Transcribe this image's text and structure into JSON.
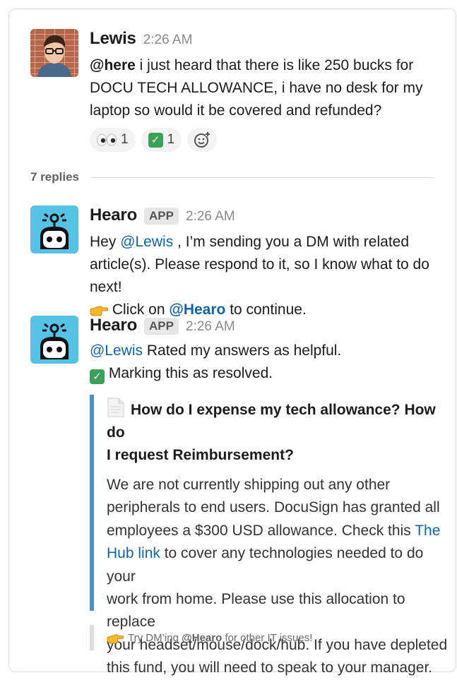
{
  "thread": {
    "replies_label": "7 replies"
  },
  "original_message": {
    "author": "Lewis",
    "time": "2:26 AM",
    "mention": "@here",
    "line1": " i just heard that there is like 250 bucks for",
    "line2": "DOCU TECH ALLOWANCE, i have no desk for my",
    "line3": "laptop so would it be covered and refunded?",
    "reactions": [
      {
        "emoji": "eyes-icon",
        "count": "1"
      },
      {
        "emoji": "white-check-mark-icon",
        "count": "1"
      }
    ]
  },
  "reply1": {
    "author": "Hearo",
    "badge": "APP",
    "time": "2:26 AM",
    "pre": "Hey ",
    "mention": "@Lewis",
    "post": " , I’m sending you a DM with related",
    "line2": "article(s). Please respond to it, so I know what to do next!",
    "click_pre": " Click on ",
    "click_mention": "@Hearo",
    "click_post": " to continue."
  },
  "reply2": {
    "author": "Hearo",
    "badge": "APP",
    "time": "2:26 AM",
    "mention": "@Lewis",
    "rated": " Rated my answers as helpful.",
    "resolved": " Marking this as resolved.",
    "attachment": {
      "title_line1": "How do I expense my tech allowance? How do",
      "title_line2": "I request Reimbursement?",
      "b1": "We are not currently shipping out any other",
      "b2": "peripherals to end users. DocuSign has granted all",
      "b3_pre": "employees a $300 USD allowance. Check this ",
      "b3_link": "The",
      "b4_link": "Hub link",
      "b4_post": " to cover any technologies needed to do your",
      "b5": "work from home. Please use this allocation to replace",
      "b6": "your headset/mouse/dock/hub. If you have depleted",
      "b7": "this fund, you will need to speak to your manager."
    },
    "footer_pre": "Try DM’ing ",
    "footer_mention": "@Hearo",
    "footer_post": " for other IT issues!"
  }
}
